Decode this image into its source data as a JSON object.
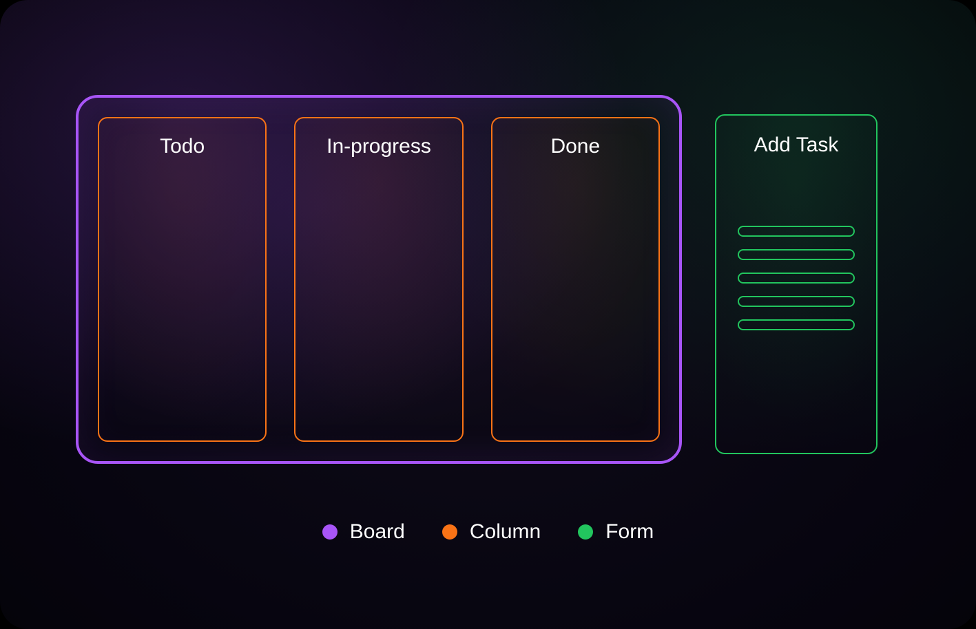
{
  "board": {
    "columns": [
      {
        "title": "Todo"
      },
      {
        "title": "In-progress"
      },
      {
        "title": "Done"
      }
    ]
  },
  "form": {
    "title": "Add Task",
    "field_count": 5
  },
  "legend": {
    "items": [
      {
        "label": "Board",
        "color": "purple"
      },
      {
        "label": "Column",
        "color": "orange"
      },
      {
        "label": "Form",
        "color": "green"
      }
    ]
  },
  "colors": {
    "purple": "#A855F7",
    "orange": "#F97316",
    "green": "#22C55E"
  }
}
